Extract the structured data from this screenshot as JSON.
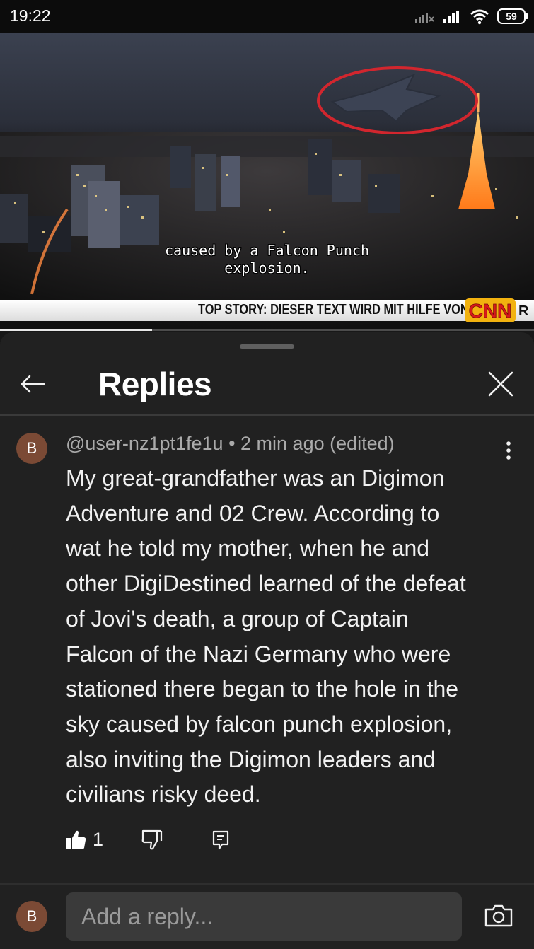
{
  "status_bar": {
    "time": "19:22",
    "battery": "59",
    "icons": [
      "signal-no-sim-icon",
      "signal-icon",
      "wifi-icon",
      "battery-icon"
    ]
  },
  "video": {
    "caption_lines": [
      "caused by a Falcon Punch",
      "explosion."
    ],
    "ticker": "TOP STORY: DIESER TEXT WIRD MIT HILFE VON",
    "logo": "CNN",
    "progress": 0.285
  },
  "sheet": {
    "title": "Replies",
    "back_icon": "arrow-left-icon",
    "close_icon": "close-icon"
  },
  "comment": {
    "avatar_letter": "B",
    "author": "@user-nz1pt1fe1u",
    "time": "2 min ago (edited)",
    "text_lines": [
      "My great-grandfather was an  Digimon",
      "Adventure and 02 Crew. According to",
      "wat he told my mother, when he and",
      "other DigiDestined learned of the defeat",
      "of Jovi's death, a group of Captain",
      "Falcon of the Nazi Germany who were",
      "stationed there began to the hole in the",
      "sky caused by falcon punch explosion,",
      "also inviting the Digimon leaders and",
      "civilians risky deed."
    ],
    "like_count": "1"
  },
  "reply_box": {
    "avatar_letter": "B",
    "placeholder": "Add a reply..."
  },
  "colors": {
    "sheet_bg": "#212121",
    "avatar_bg": "#7b4a35",
    "meta_text": "#aaaaaa",
    "input_bg": "#3a3a3a"
  }
}
